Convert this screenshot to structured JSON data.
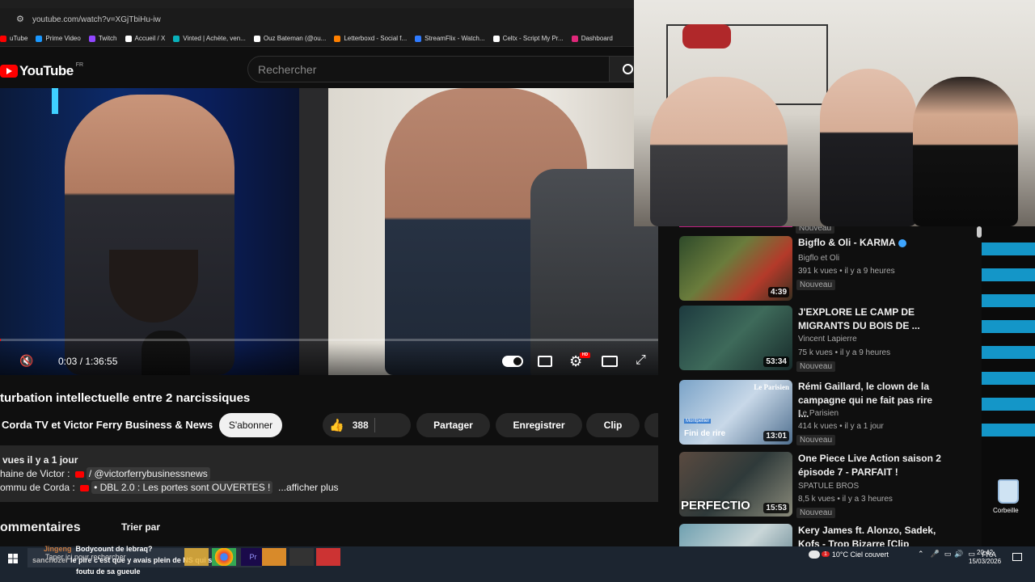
{
  "browser": {
    "url": "youtube.com/watch?v=XGjTbiHu-iw",
    "bookmarks": [
      {
        "label": "uTube",
        "color": "#ff0000"
      },
      {
        "label": "Prime Video",
        "color": "#1a98ff"
      },
      {
        "label": "Twitch",
        "color": "#9146ff"
      },
      {
        "label": "Accueil / X",
        "color": "#ffffff"
      },
      {
        "label": "Vinted | Achète, ven...",
        "color": "#09b1ba"
      },
      {
        "label": "Ouz Bateman (@ou...",
        "color": "#ffffff"
      },
      {
        "label": "Letterboxd - Social f...",
        "color": "#ff8000"
      },
      {
        "label": "StreamFlix - Watch...",
        "color": "#2f7bff"
      },
      {
        "label": "Celtx - Script My Pr...",
        "color": "#ffffff"
      },
      {
        "label": "Dashboard",
        "color": "#e0287a"
      }
    ]
  },
  "youtube": {
    "logo_text": "YouTube",
    "region": "FR",
    "search_placeholder": "Rechercher"
  },
  "player": {
    "time": "0:03 / 1:36:55",
    "hd_badge": "HD",
    "progress": 0.0005
  },
  "video": {
    "title": "turbation intellectuelle entre 2 narcissiques",
    "channel": "Corda TV et Victor Ferry Business & News",
    "subscribe": "S'abonner",
    "likes": "388",
    "share": "Partager",
    "save": "Enregistrer",
    "clip": "Clip"
  },
  "description": {
    "meta": "vues  il y a 1 jour",
    "line2_prefix": "haine de Victor :",
    "line2_link": "/ @victorferrybusinessnews",
    "line3_prefix": "ommu de Corda :",
    "line3_link": "• DBL 2.0 : Les portes sont OUVERTES !",
    "more": "...afficher plus"
  },
  "comments": {
    "heading": "ommentaires",
    "sort": "Trier par"
  },
  "sidebar": {
    "top_badge": "Nouveau",
    "items": [
      {
        "title": "Bigflo & Oli - KARMA",
        "channel": "Bigflo et Oli",
        "views": "391 k vues • il y a 9 heures",
        "badge": "Nouveau",
        "duration": "4:39"
      },
      {
        "title": "J'EXPLORE LE CAMP DE MIGRANTS DU BOIS DE ...",
        "channel": "Vincent Lapierre",
        "views": "75 k vues • il y a 9 heures",
        "badge": "Nouveau",
        "duration": "53:34"
      },
      {
        "title": "Rémi Gaillard, le clown de la campagne qui ne fait pas rire l...",
        "channel": "Le Parisien",
        "views": "414 k vues • il y a 1 jour",
        "badge": "Nouveau",
        "duration": "13:01",
        "overlay1": "Le Parisien",
        "overlay2": "Montpellier",
        "overlay3": "Fini de rire"
      },
      {
        "title": "One Piece Live Action saison 2 épisode 7  - PARFAIT !",
        "channel": "SPATULE BROS",
        "views": "8,5 k vues • il y a 3 heures",
        "badge": "Nouveau",
        "duration": "15:53",
        "overlay1": "PERFECTIO"
      },
      {
        "title": "Kery James ft. Alonzo, Sadek, Kofs - Trop Bizarre [Clip officiel]",
        "channel": "",
        "views": "",
        "badge": "",
        "duration": ""
      }
    ]
  },
  "desktop": {
    "recycle_bin": "Corbeille"
  },
  "taskbar": {
    "search_placeholder": "Taper ici pour rechercher",
    "chat": [
      {
        "user": "Jingeng",
        "msg": "Bodycount de lebraq?"
      },
      {
        "user": "sanchozer",
        "msg": "le pire c'est que y avais plein de NS qui s'etait"
      },
      {
        "user": "",
        "msg": "foutu de sa gueule"
      }
    ],
    "weather": "10°C  Ciel couvert",
    "weather_badge": "1",
    "lang": "FRA",
    "time": "20:42",
    "date": "15/03/2026"
  }
}
